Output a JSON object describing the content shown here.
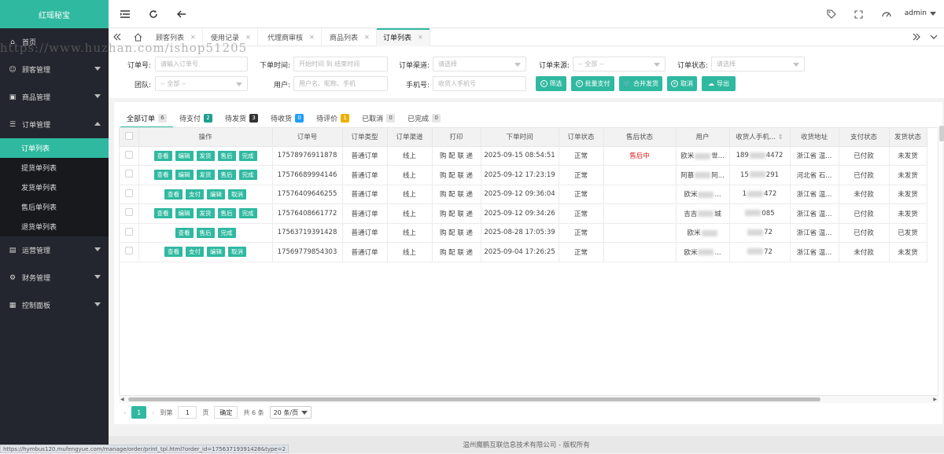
{
  "brand": "红瑶秘宝",
  "watermark": "https://www.huzhan.com/ishop51205",
  "status_url": "https://hymbus120.mufengyue.com/manage/order/print_tpl.html?order_id=17563719391428&type=2",
  "sidebar": {
    "items": [
      {
        "label": "首页",
        "icon": "home-icon"
      },
      {
        "label": "顾客管理",
        "icon": "user-icon"
      },
      {
        "label": "商品管理",
        "icon": "shop-icon"
      },
      {
        "label": "订单管理",
        "icon": "list-icon"
      },
      {
        "label": "运营管理",
        "icon": "chart-icon"
      },
      {
        "label": "财务管理",
        "icon": "finance-icon"
      },
      {
        "label": "控制面板",
        "icon": "panel-icon"
      }
    ],
    "sub_items": [
      "订单列表",
      "提货单列表",
      "发货单列表",
      "售后单列表",
      "退货单列表"
    ]
  },
  "topbar": {
    "user": "admin"
  },
  "tabs": [
    "顾客列表",
    "使用记录",
    "代理商审核",
    "商品列表",
    "订单列表"
  ],
  "filters": {
    "order_no": {
      "label": "订单号:",
      "placeholder": "请输入订单号"
    },
    "time": {
      "label": "下单时间:",
      "placeholder": "开始时间 到 结束时间"
    },
    "channel": {
      "label": "订单渠道:",
      "placeholder": "请选择"
    },
    "source": {
      "label": "订单来源:",
      "placeholder": "-- 全部 --"
    },
    "status": {
      "label": "订单状态:",
      "placeholder": "请选择"
    },
    "team": {
      "label": "团队:",
      "placeholder": "-- 全部 --"
    },
    "user": {
      "label": "用户:",
      "placeholder": "用户名、昵称、手机"
    },
    "phone": {
      "label": "手机号:",
      "placeholder": "收货人手机号"
    }
  },
  "buttons": [
    "筛选",
    "批量支付",
    "合并发货",
    "取消",
    "导出"
  ],
  "status_tabs": [
    {
      "label": "全部订单",
      "count": "6",
      "color": "#e5e5e5"
    },
    {
      "label": "待支付",
      "count": "2",
      "color": "#1e9f8b"
    },
    {
      "label": "待发货",
      "count": "3",
      "color": "#333333"
    },
    {
      "label": "待收货",
      "count": "0",
      "color": "#1e9fff"
    },
    {
      "label": "待评价",
      "count": "1",
      "color": "#f0b000"
    },
    {
      "label": "已取消",
      "count": "0",
      "color": "#e5e5e5"
    },
    {
      "label": "已完成",
      "count": "0",
      "color": "#e5e5e5"
    }
  ],
  "table": {
    "headers": [
      "操作",
      "订单号",
      "订单类型",
      "订单渠道",
      "打印",
      "下单时间",
      "订单状态",
      "售后状态",
      "用户",
      "收货人手机...",
      "收货地址",
      "支付状态",
      "发货状态"
    ],
    "rows": [
      {
        "actions": [
          "查看",
          "编辑",
          "发货",
          "售后",
          "完成"
        ],
        "order_no": "17578976911878",
        "type": "普通订单",
        "channel": "线上",
        "print": "购 配 联 递",
        "time": "2025-09-15 08:54:51",
        "status": "正常",
        "after_sale": "售后中",
        "user_a": "欧米",
        "user_b": "世...",
        "phone_a": "189",
        "phone_b": "4472",
        "addr": "浙江省 温...",
        "pay": "已付款",
        "ship": "未发货"
      },
      {
        "actions": [
          "查看",
          "编辑",
          "发货",
          "售后",
          "完成"
        ],
        "order_no": "17576689994146",
        "type": "普通订单",
        "channel": "线上",
        "print": "购 配 联 递",
        "time": "2025-09-12 17:23:19",
        "status": "正常",
        "after_sale": "",
        "user_a": "阿慕",
        "user_b": "阿...",
        "phone_a": "15",
        "phone_b": "291",
        "addr": "河北省 石...",
        "pay": "已付款",
        "ship": "未发货"
      },
      {
        "actions": [
          "查看",
          "支付",
          "编辑",
          "取消"
        ],
        "order_no": "17576409646255",
        "type": "普通订单",
        "channel": "线上",
        "print": "购 配 联 递",
        "time": "2025-09-12 09:36:04",
        "status": "正常",
        "after_sale": "",
        "user_a": "欧米",
        "user_b": "...",
        "phone_a": "1",
        "phone_b": "472",
        "addr": "浙江省 温...",
        "pay": "未付款",
        "ship": "未发货"
      },
      {
        "actions": [
          "查看",
          "编辑",
          "发货",
          "售后",
          "完成"
        ],
        "order_no": "17576408661772",
        "type": "普通订单",
        "channel": "线上",
        "print": "购 配 联 递",
        "time": "2025-09-12 09:34:26",
        "status": "正常",
        "after_sale": "",
        "user_a": "吉吉",
        "user_b": "城",
        "phone_a": "",
        "phone_b": "085",
        "addr": "浙江省 温...",
        "pay": "已付款",
        "ship": "未发货"
      },
      {
        "actions": [
          "查看",
          "售后",
          "完成"
        ],
        "order_no": "17563719391428",
        "type": "普通订单",
        "channel": "线上",
        "print": "购 配 联 递",
        "time": "2025-08-28 17:05:39",
        "status": "正常",
        "after_sale": "",
        "user_a": "欧米",
        "user_b": "",
        "phone_a": "",
        "phone_b": "72",
        "addr": "浙江省 温...",
        "pay": "已付款",
        "ship": "已发货"
      },
      {
        "actions": [
          "查看",
          "支付",
          "编辑",
          "取消"
        ],
        "order_no": "17569779854303",
        "type": "普通订单",
        "channel": "线上",
        "print": "购 配 联 递",
        "time": "2025-09-04 17:26:25",
        "status": "正常",
        "after_sale": "",
        "user_a": "欧米",
        "user_b": "...",
        "phone_a": "",
        "phone_b": "72",
        "addr": "浙江省 温...",
        "pay": "未付款",
        "ship": "未发货"
      }
    ]
  },
  "pager": {
    "current": "1",
    "goto": "到第",
    "page_value": "1",
    "page_unit": "页",
    "confirm": "确定",
    "total": "共 6 条",
    "size": "20 条/页"
  },
  "footer": "温州魔鹏互联信息技术有限公司 - 版权所有"
}
